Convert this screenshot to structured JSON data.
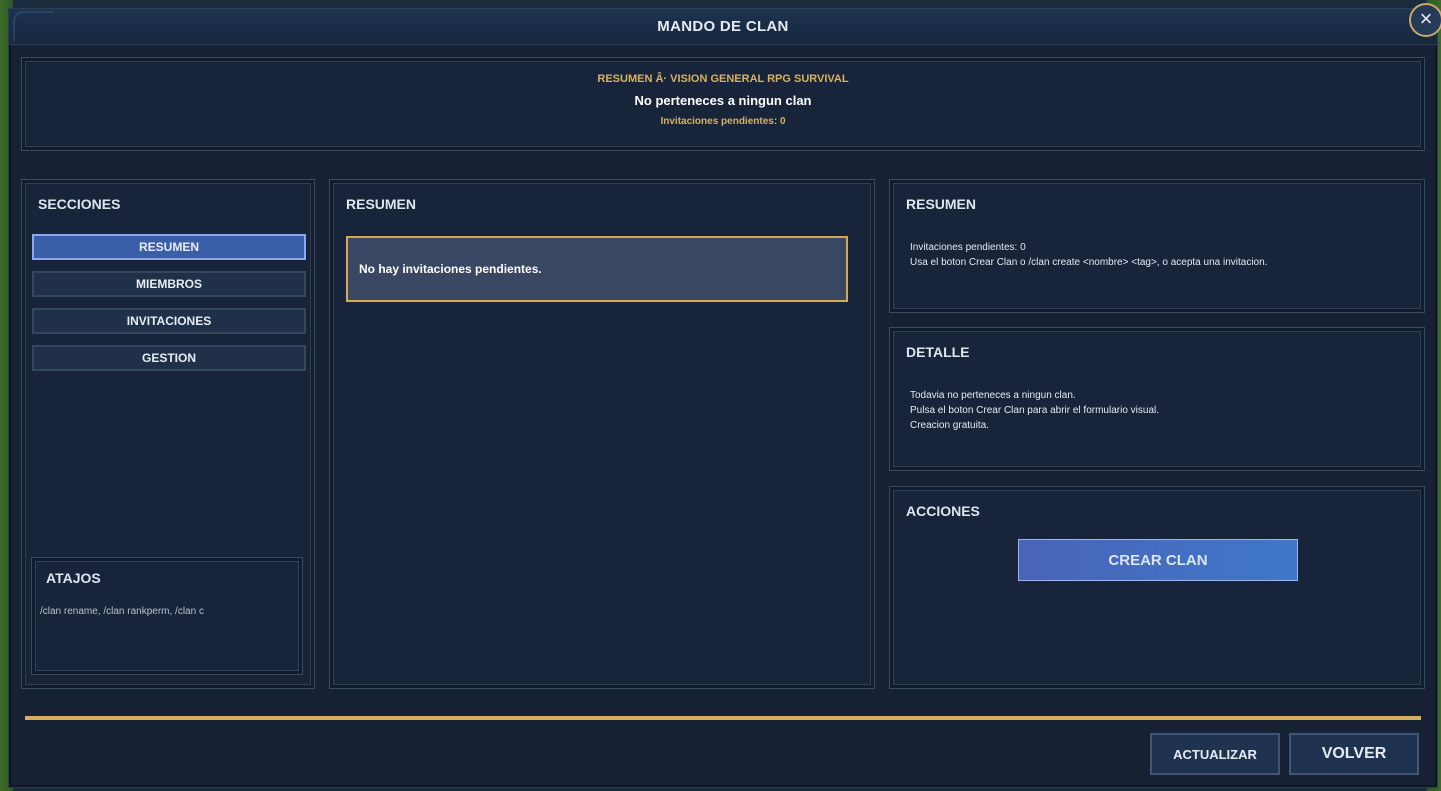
{
  "window": {
    "title": "MANDO DE CLAN",
    "close_icon": "×"
  },
  "header": {
    "subtitle": "RESUMEN Â· VISION GENERAL RPG SURVIVAL",
    "status": "No perteneces a ningun clan",
    "pending": "Invitaciones pendientes: 0"
  },
  "sections": {
    "title": "SECCIONES",
    "items": [
      {
        "label": "RESUMEN",
        "active": true
      },
      {
        "label": "MIEMBROS",
        "active": false
      },
      {
        "label": "INVITACIONES",
        "active": false
      },
      {
        "label": "GESTION",
        "active": false
      }
    ]
  },
  "shortcuts": {
    "title": "ATAJOS",
    "text": "/clan rename, /clan rankperm, /clan c"
  },
  "center": {
    "title": "RESUMEN",
    "empty_message": "No hay invitaciones pendientes."
  },
  "summary": {
    "title": "RESUMEN",
    "lines": [
      "Invitaciones pendientes: 0",
      "Usa el boton Crear Clan o /clan create <nombre> <tag>, o acepta una invitacion."
    ]
  },
  "detail": {
    "title": "DETALLE",
    "lines": [
      "Todavia no perteneces a ningun clan.",
      "Pulsa el boton Crear Clan para abrir el formulario visual.",
      "Creacion gratuita."
    ]
  },
  "actions": {
    "title": "ACCIONES",
    "create_label": "CREAR CLAN"
  },
  "footer": {
    "refresh_label": "ACTUALIZAR",
    "back_label": "VOLVER"
  },
  "colors": {
    "accent_gold": "#d6ae62",
    "active_blue": "#3a5fa8",
    "panel_bg": "#17243a"
  }
}
